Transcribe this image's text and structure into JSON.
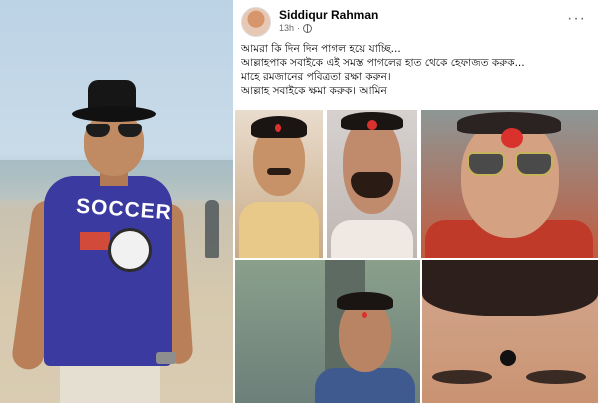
{
  "post": {
    "author_name": "Siddiqur Rahman",
    "timestamp": "13h",
    "separator": "·",
    "more_options": "···",
    "text_lines": [
      "আমরা কি দিন দিন পাগল হয়ে যাচ্ছি...",
      "আল্লাহপাক সবাইকে এই সমস্ত পাগলের হাত থেকে হেফাজত করুক...",
      "মাহে রমজানের পবিত্রতা রক্ষা করুন।",
      "আল্লাহ সবাইকে ক্ষমা করুক। আমিন"
    ]
  },
  "left_photo": {
    "shirt_text": "SOCCER"
  },
  "colors": {
    "bindi_red": "#d9322c",
    "bindi_black": "#111111",
    "name_text": "#050505",
    "meta_text": "#65676b"
  }
}
